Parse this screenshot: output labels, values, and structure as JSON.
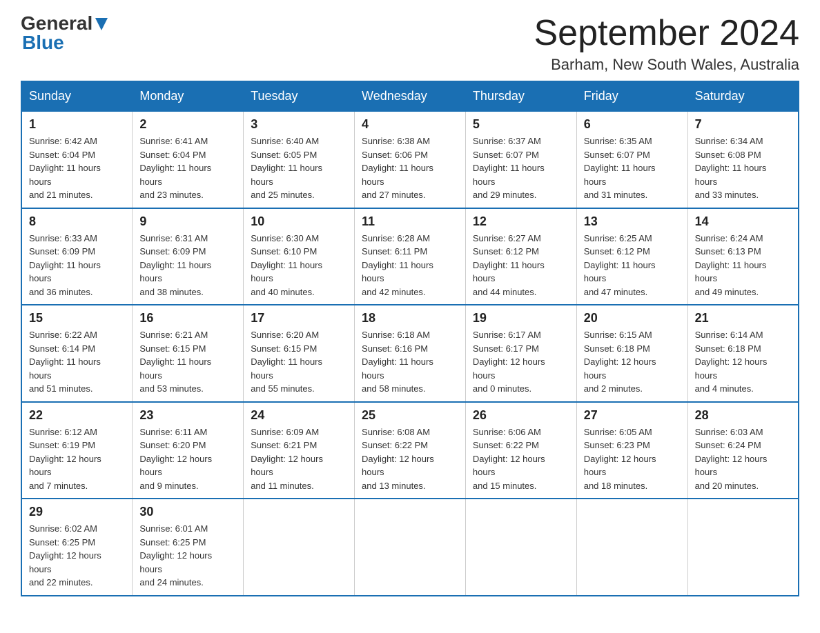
{
  "header": {
    "logo_general": "General",
    "logo_blue": "Blue",
    "month_title": "September 2024",
    "location": "Barham, New South Wales, Australia"
  },
  "weekdays": [
    "Sunday",
    "Monday",
    "Tuesday",
    "Wednesday",
    "Thursday",
    "Friday",
    "Saturday"
  ],
  "weeks": [
    [
      {
        "day": "1",
        "sunrise": "6:42 AM",
        "sunset": "6:04 PM",
        "daylight": "11 hours and 21 minutes."
      },
      {
        "day": "2",
        "sunrise": "6:41 AM",
        "sunset": "6:04 PM",
        "daylight": "11 hours and 23 minutes."
      },
      {
        "day": "3",
        "sunrise": "6:40 AM",
        "sunset": "6:05 PM",
        "daylight": "11 hours and 25 minutes."
      },
      {
        "day": "4",
        "sunrise": "6:38 AM",
        "sunset": "6:06 PM",
        "daylight": "11 hours and 27 minutes."
      },
      {
        "day": "5",
        "sunrise": "6:37 AM",
        "sunset": "6:07 PM",
        "daylight": "11 hours and 29 minutes."
      },
      {
        "day": "6",
        "sunrise": "6:35 AM",
        "sunset": "6:07 PM",
        "daylight": "11 hours and 31 minutes."
      },
      {
        "day": "7",
        "sunrise": "6:34 AM",
        "sunset": "6:08 PM",
        "daylight": "11 hours and 33 minutes."
      }
    ],
    [
      {
        "day": "8",
        "sunrise": "6:33 AM",
        "sunset": "6:09 PM",
        "daylight": "11 hours and 36 minutes."
      },
      {
        "day": "9",
        "sunrise": "6:31 AM",
        "sunset": "6:09 PM",
        "daylight": "11 hours and 38 minutes."
      },
      {
        "day": "10",
        "sunrise": "6:30 AM",
        "sunset": "6:10 PM",
        "daylight": "11 hours and 40 minutes."
      },
      {
        "day": "11",
        "sunrise": "6:28 AM",
        "sunset": "6:11 PM",
        "daylight": "11 hours and 42 minutes."
      },
      {
        "day": "12",
        "sunrise": "6:27 AM",
        "sunset": "6:12 PM",
        "daylight": "11 hours and 44 minutes."
      },
      {
        "day": "13",
        "sunrise": "6:25 AM",
        "sunset": "6:12 PM",
        "daylight": "11 hours and 47 minutes."
      },
      {
        "day": "14",
        "sunrise": "6:24 AM",
        "sunset": "6:13 PM",
        "daylight": "11 hours and 49 minutes."
      }
    ],
    [
      {
        "day": "15",
        "sunrise": "6:22 AM",
        "sunset": "6:14 PM",
        "daylight": "11 hours and 51 minutes."
      },
      {
        "day": "16",
        "sunrise": "6:21 AM",
        "sunset": "6:15 PM",
        "daylight": "11 hours and 53 minutes."
      },
      {
        "day": "17",
        "sunrise": "6:20 AM",
        "sunset": "6:15 PM",
        "daylight": "11 hours and 55 minutes."
      },
      {
        "day": "18",
        "sunrise": "6:18 AM",
        "sunset": "6:16 PM",
        "daylight": "11 hours and 58 minutes."
      },
      {
        "day": "19",
        "sunrise": "6:17 AM",
        "sunset": "6:17 PM",
        "daylight": "12 hours and 0 minutes."
      },
      {
        "day": "20",
        "sunrise": "6:15 AM",
        "sunset": "6:18 PM",
        "daylight": "12 hours and 2 minutes."
      },
      {
        "day": "21",
        "sunrise": "6:14 AM",
        "sunset": "6:18 PM",
        "daylight": "12 hours and 4 minutes."
      }
    ],
    [
      {
        "day": "22",
        "sunrise": "6:12 AM",
        "sunset": "6:19 PM",
        "daylight": "12 hours and 7 minutes."
      },
      {
        "day": "23",
        "sunrise": "6:11 AM",
        "sunset": "6:20 PM",
        "daylight": "12 hours and 9 minutes."
      },
      {
        "day": "24",
        "sunrise": "6:09 AM",
        "sunset": "6:21 PM",
        "daylight": "12 hours and 11 minutes."
      },
      {
        "day": "25",
        "sunrise": "6:08 AM",
        "sunset": "6:22 PM",
        "daylight": "12 hours and 13 minutes."
      },
      {
        "day": "26",
        "sunrise": "6:06 AM",
        "sunset": "6:22 PM",
        "daylight": "12 hours and 15 minutes."
      },
      {
        "day": "27",
        "sunrise": "6:05 AM",
        "sunset": "6:23 PM",
        "daylight": "12 hours and 18 minutes."
      },
      {
        "day": "28",
        "sunrise": "6:03 AM",
        "sunset": "6:24 PM",
        "daylight": "12 hours and 20 minutes."
      }
    ],
    [
      {
        "day": "29",
        "sunrise": "6:02 AM",
        "sunset": "6:25 PM",
        "daylight": "12 hours and 22 minutes."
      },
      {
        "day": "30",
        "sunrise": "6:01 AM",
        "sunset": "6:25 PM",
        "daylight": "12 hours and 24 minutes."
      },
      null,
      null,
      null,
      null,
      null
    ]
  ],
  "labels": {
    "sunrise": "Sunrise:",
    "sunset": "Sunset:",
    "daylight": "Daylight:"
  }
}
